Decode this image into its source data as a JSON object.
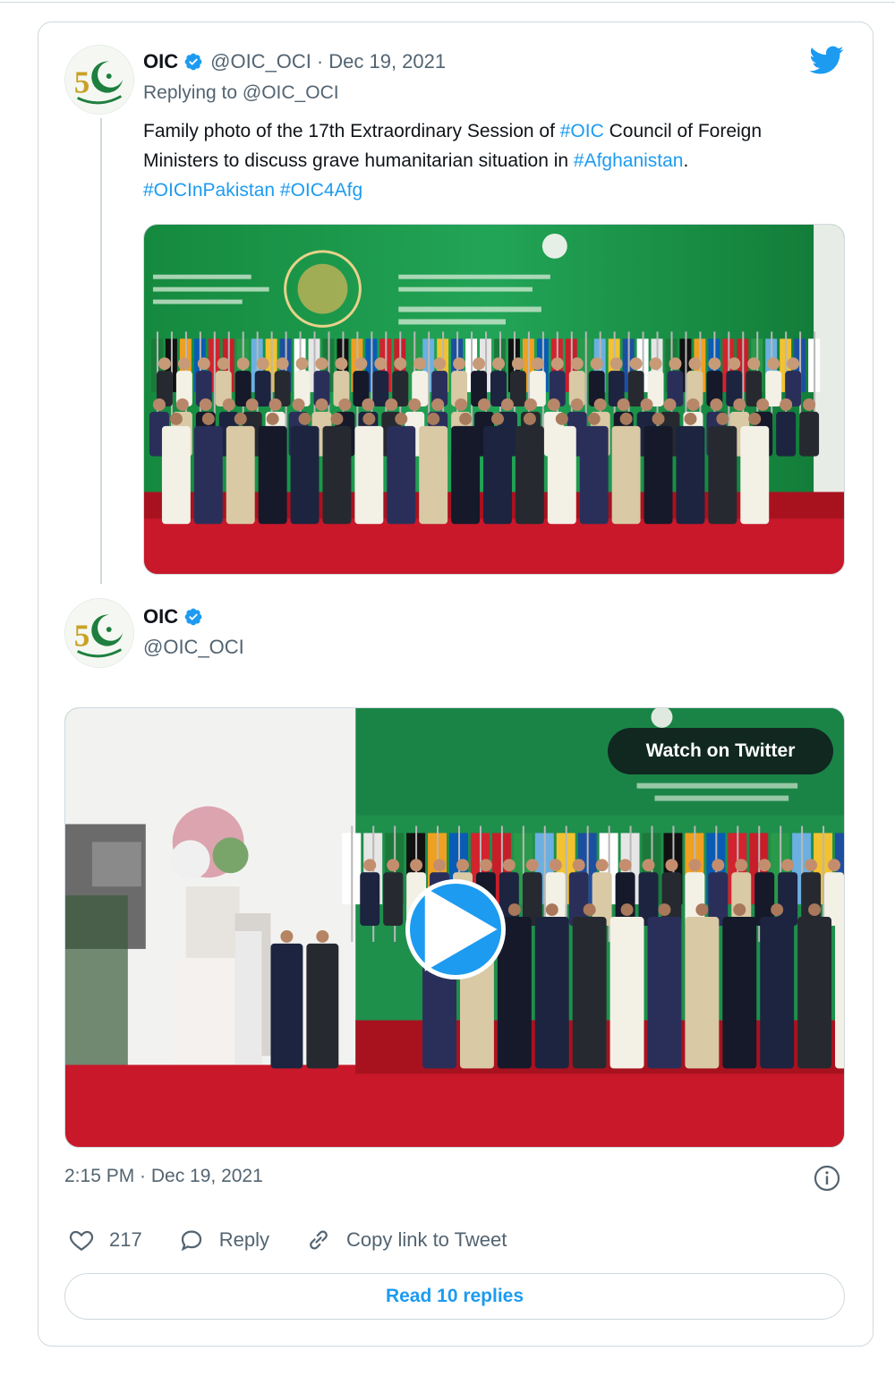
{
  "tweet1": {
    "author_name": "OIC",
    "handle": "@OIC_OCI",
    "separator": "·",
    "date": "Dec 19, 2021",
    "replying_prefix": "Replying to",
    "replying_to": "@OIC_OCI",
    "text_part1": "Family photo of the 17th Extraordinary Session of ",
    "hashtag1": "#OIC",
    "text_part2": " Council of Foreign Ministers to discuss grave humanitarian situation in ",
    "hashtag2": "#Afghanistan",
    "text_part3": ". ",
    "hashtag3": "#OICInPakistan",
    "text_part4": " ",
    "hashtag4": "#OIC4Afg",
    "photo_icon": "family-photo"
  },
  "tweet2": {
    "author_name": "OIC",
    "handle": "@OIC_OCI",
    "watch_label": "Watch on Twitter",
    "timestamp": "2:15 PM · Dec 19, 2021"
  },
  "actions": {
    "like_count": "217",
    "reply_label": "Reply",
    "copy_label": "Copy link to Tweet"
  },
  "read_replies_label": "Read 10 replies",
  "colors": {
    "accent": "#1d9bf0",
    "muted": "#536471",
    "border": "#cfd9de",
    "backdrop_green": "#1e8a4a",
    "carpet_red": "#c8182a"
  },
  "icons": {
    "verified": "verified-badge-icon",
    "twitter": "twitter-bird-icon",
    "info": "info-icon",
    "like": "heart-icon",
    "reply": "reply-bubble-icon",
    "copy": "link-icon",
    "play": "play-icon"
  }
}
